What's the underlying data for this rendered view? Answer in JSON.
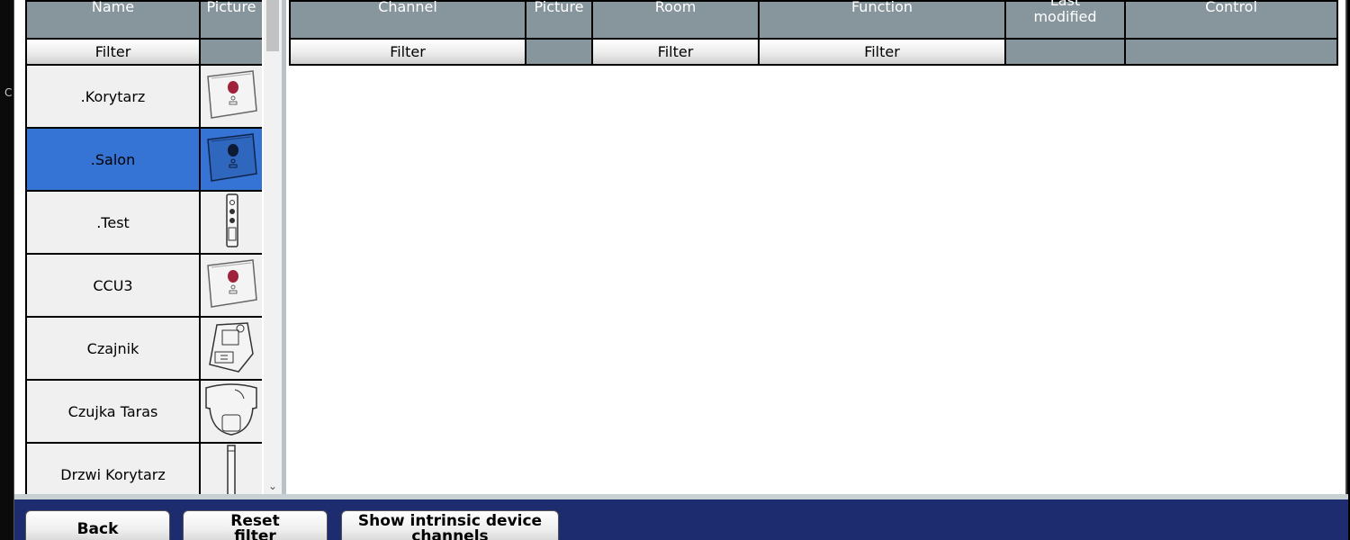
{
  "desktop": {
    "edge_char": "C"
  },
  "device_table": {
    "columns": [
      "Name",
      "Picture"
    ],
    "filter_label": "Filter",
    "rows": [
      {
        "name": ".Korytarz",
        "icon": "ccu-device-icon",
        "selected": false
      },
      {
        "name": ".Salon",
        "icon": "ccu-device-icon",
        "selected": true
      },
      {
        "name": ".Test",
        "icon": "remote-device-icon",
        "selected": false
      },
      {
        "name": "CCU3",
        "icon": "ccu-device-icon",
        "selected": false
      },
      {
        "name": "Czajnik",
        "icon": "actuator-module-icon",
        "selected": false
      },
      {
        "name": "Czujka Taras",
        "icon": "motion-detector-icon",
        "selected": false
      },
      {
        "name": "Drzwi Korytarz",
        "icon": "door-sensor-icon",
        "selected": false
      }
    ]
  },
  "channel_table": {
    "columns": {
      "channel": "Channel",
      "picture": "Picture",
      "room": "Room",
      "function": "Function",
      "last_modified_1": "Last",
      "last_modified_2": "modified",
      "control": "Control"
    },
    "filter_label": "Filter"
  },
  "footer": {
    "back": "Back",
    "reset_1": "Reset",
    "reset_2": "filter",
    "intrinsic_1": "Show intrinsic device",
    "intrinsic_2": "channels"
  },
  "colors": {
    "header_bg": "#87969d",
    "selected_row": "#3574d4",
    "footer_bg": "#1c2c6e"
  }
}
